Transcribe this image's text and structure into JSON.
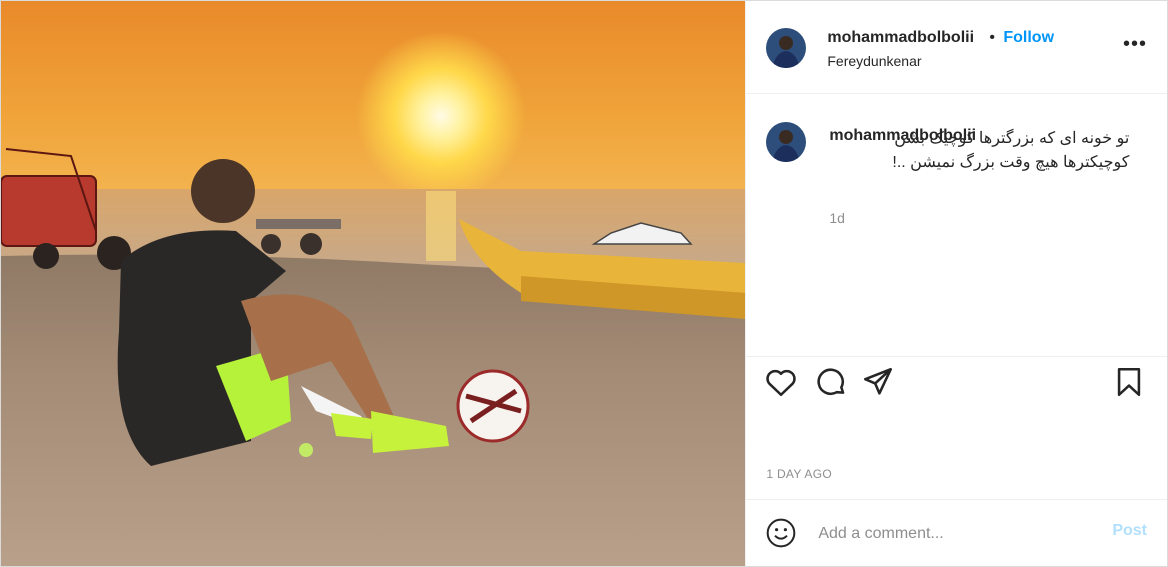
{
  "post": {
    "username": "mohammadbolbolii",
    "location": "Fereydunkenar",
    "follow_label": "Follow",
    "separator": "•",
    "more_label": "•••",
    "caption": {
      "username": "mohammadbolbolii",
      "text": "تو خونه ای که بزرگترها کوچیک بشن کوچیکترها هیچ وقت بزرگ نمیشن ..!",
      "time": "1d"
    },
    "date_label": "1 DAY AGO",
    "comment_placeholder": "Add a comment...",
    "post_label": "Post"
  },
  "icons": {
    "like": "heart-icon",
    "comment": "comment-icon",
    "share": "paper-plane-icon",
    "save": "bookmark-icon",
    "emoji": "smiley-icon"
  },
  "colors": {
    "follow": "#0095f6",
    "post_disabled": "#b2dffc",
    "secondary_text": "#8e8e8e"
  }
}
